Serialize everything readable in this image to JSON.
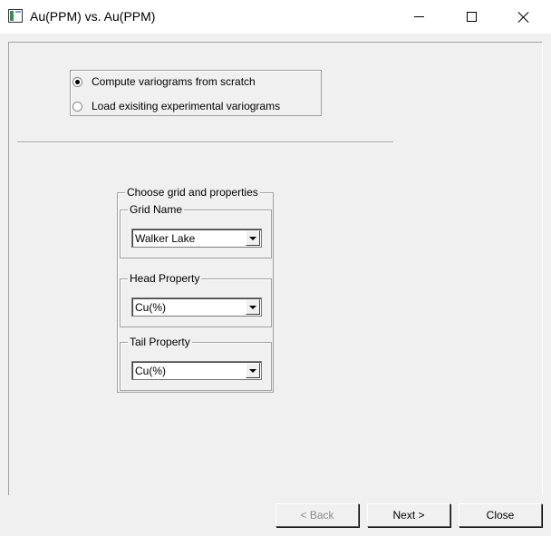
{
  "window": {
    "title": "Au(PPM) vs. Au(PPM)",
    "icon": "app-window-icon",
    "controls": [
      "minimize-icon",
      "maximize-icon",
      "close-icon"
    ]
  },
  "mode": {
    "options": [
      {
        "label": "Compute variograms from scratch",
        "checked": true
      },
      {
        "label": "Load exisiting experimental variograms",
        "checked": false
      }
    ]
  },
  "selection": {
    "title": "Choose grid and properties",
    "grid": {
      "label": "Grid Name",
      "value": "Walker Lake"
    },
    "head": {
      "label": "Head Property",
      "value": "Cu(%)"
    },
    "tail": {
      "label": "Tail Property",
      "value": "Cu(%)"
    }
  },
  "buttons": {
    "back": "< Back",
    "next": "Next >",
    "close": "Close"
  }
}
